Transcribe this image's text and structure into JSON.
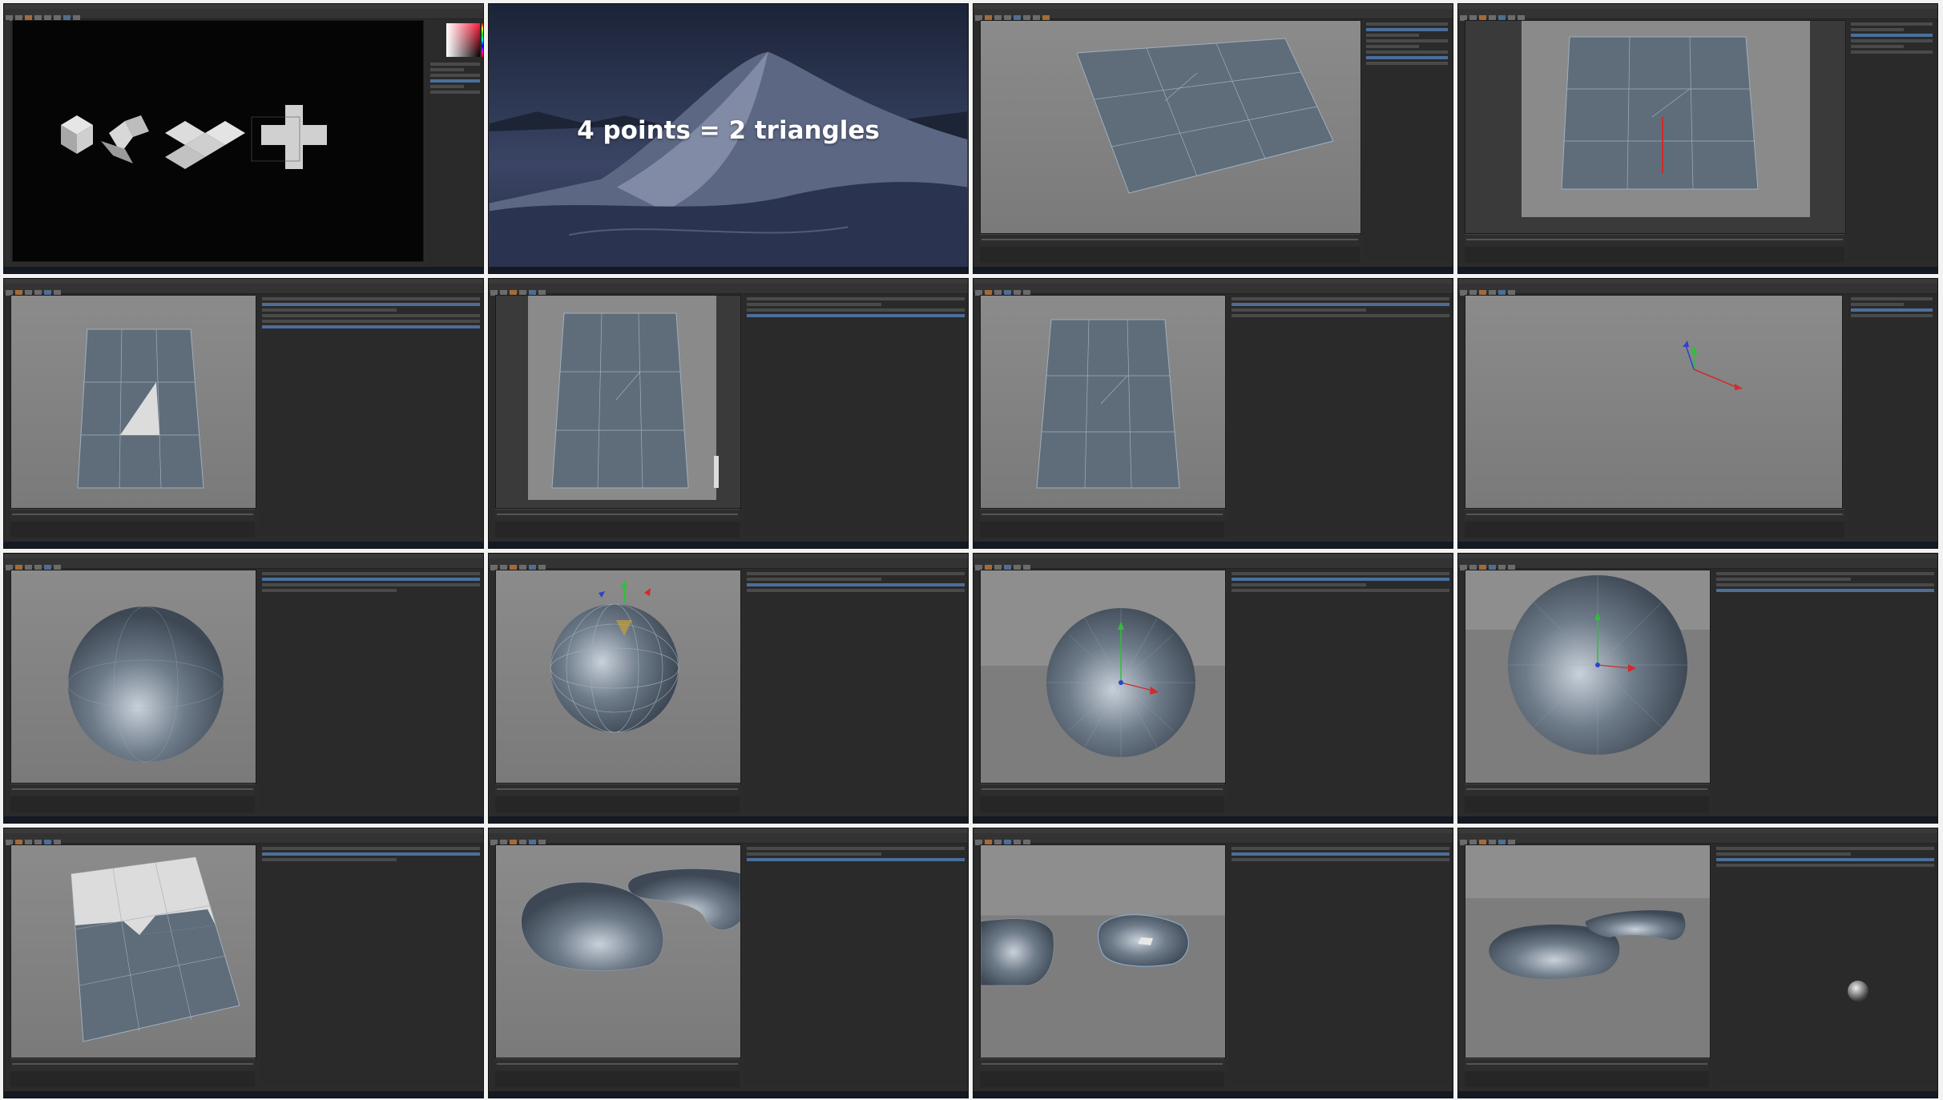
{
  "sheet": {
    "title_slide_text": "4 points = 2 triangles",
    "colors": {
      "background": "#f2f2f2",
      "app_dark": "#2b2b2b",
      "viewport_gray": "#828282",
      "mesh_blue": "#5f6c7a",
      "wire": "#9fb0bf",
      "axis_x": "#d12b2b",
      "axis_y": "#2fbf3b",
      "axis_z": "#2d43c9",
      "accent_orange": "#a36b3a"
    },
    "thumbnails": [
      {
        "scene": "photoshop-cube-unfold",
        "app": "photoshop"
      },
      {
        "scene": "title-slide-desert",
        "app": "slide"
      },
      {
        "scene": "plane-subdivided",
        "app": "cinema4d"
      },
      {
        "scene": "plane-front-point-drag",
        "app": "cinema4d"
      },
      {
        "scene": "plane-triangle-selected",
        "app": "cinema4d"
      },
      {
        "scene": "plane-front-edges",
        "app": "cinema4d"
      },
      {
        "scene": "plane-edges",
        "app": "cinema4d"
      },
      {
        "scene": "empty-axis-gizmo",
        "app": "cinema4d"
      },
      {
        "scene": "sphere-smooth",
        "app": "cinema4d"
      },
      {
        "scene": "sphere-wire-gizmo",
        "app": "cinema4d"
      },
      {
        "scene": "sphere-triangulated",
        "app": "cinema4d"
      },
      {
        "scene": "sphere-large-gizmo",
        "app": "cinema4d"
      },
      {
        "scene": "plane-polygons-selected",
        "app": "cinema4d"
      },
      {
        "scene": "blob-shapes",
        "app": "cinema4d"
      },
      {
        "scene": "blob-selected-polygon",
        "app": "cinema4d"
      },
      {
        "scene": "blob-smooth-material",
        "app": "cinema4d"
      }
    ]
  }
}
